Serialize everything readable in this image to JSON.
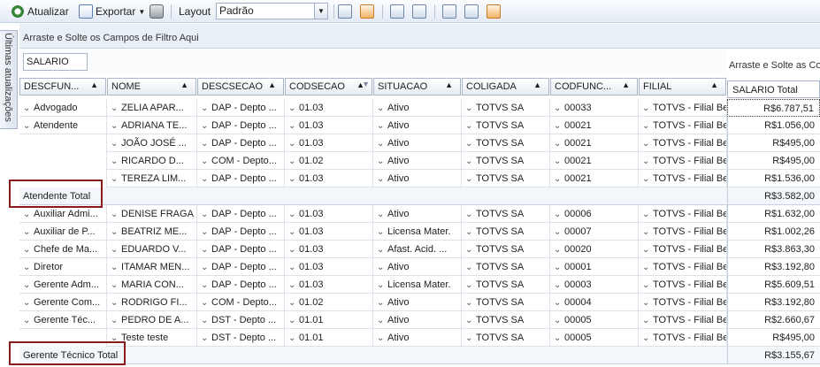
{
  "toolbar": {
    "refresh_label": "Atualizar",
    "export_label": "Exportar",
    "layout_label": "Layout",
    "layout_value": "Padrão"
  },
  "sidetab": {
    "label": "Últimas atualizações"
  },
  "grid": {
    "filter_area_hint": "Arraste e Solte os Campos de Filtro Aqui",
    "data_field": "SALARIO",
    "column_area_hint": "Arraste e Solte as Co",
    "value_header": "SALARIO Total",
    "row_headers": [
      "DESCFUN...",
      "NOME",
      "DESCSECAO",
      "CODSECAO",
      "SITUACAO",
      "COLIGADA",
      "CODFUNC...",
      "FILIAL"
    ],
    "rows": [
      {
        "c": [
          "Advogado",
          "ZELIA APAR...",
          "DAP - Depto ...",
          "01.03",
          "Ativo",
          "TOTVS SA",
          "00033",
          "TOTVS - Filial Be..."
        ],
        "v": "R$6.787,51"
      },
      {
        "c": [
          "Atendente",
          "ADRIANA TE...",
          "DAP - Depto ...",
          "01.03",
          "Ativo",
          "TOTVS SA",
          "00021",
          "TOTVS - Filial Be..."
        ],
        "v": "R$1.056,00"
      },
      {
        "c": [
          "",
          "JOÃO JOSÉ ...",
          "DAP - Depto ...",
          "01.03",
          "Ativo",
          "TOTVS SA",
          "00021",
          "TOTVS - Filial Be..."
        ],
        "v": "R$495,00"
      },
      {
        "c": [
          "",
          "RICARDO D...",
          "COM - Depto...",
          "01.02",
          "Ativo",
          "TOTVS SA",
          "00021",
          "TOTVS - Filial Be..."
        ],
        "v": "R$495,00"
      },
      {
        "c": [
          "",
          "TEREZA LIM...",
          "DAP - Depto ...",
          "01.03",
          "Ativo",
          "TOTVS SA",
          "00021",
          "TOTVS - Filial Be..."
        ],
        "v": "R$1.536,00"
      },
      {
        "total": "Atendente Total",
        "v": "R$3.582,00"
      },
      {
        "c": [
          "Auxiliar Admi...",
          "DENISE FRAGA",
          "DAP - Depto ...",
          "01.03",
          "Ativo",
          "TOTVS SA",
          "00006",
          "TOTVS - Filial Be..."
        ],
        "v": "R$1.632,00"
      },
      {
        "c": [
          "Auxiliar de P...",
          "BEATRIZ ME...",
          "DAP - Depto ...",
          "01.03",
          "Licensa Mater.",
          "TOTVS SA",
          "00007",
          "TOTVS - Filial Be..."
        ],
        "v": "R$1.002,26"
      },
      {
        "c": [
          "Chefe de Ma...",
          "EDUARDO V...",
          "DAP - Depto ...",
          "01.03",
          "Afast. Acid. ...",
          "TOTVS SA",
          "00020",
          "TOTVS - Filial Be..."
        ],
        "v": "R$3.863,30"
      },
      {
        "c": [
          "Diretor",
          "ITAMAR MEN...",
          "DAP - Depto ...",
          "01.03",
          "Ativo",
          "TOTVS SA",
          "00001",
          "TOTVS - Filial Be..."
        ],
        "v": "R$3.192,80"
      },
      {
        "c": [
          "Gerente Adm...",
          "MARIA CON...",
          "DAP - Depto ...",
          "01.03",
          "Licensa Mater.",
          "TOTVS SA",
          "00003",
          "TOTVS - Filial Be..."
        ],
        "v": "R$5.609,51"
      },
      {
        "c": [
          "Gerente Com...",
          "RODRIGO FI...",
          "COM - Depto...",
          "01.02",
          "Ativo",
          "TOTVS SA",
          "00004",
          "TOTVS - Filial Be..."
        ],
        "v": "R$3.192,80"
      },
      {
        "c": [
          "Gerente Téc...",
          "PEDRO DE A...",
          "DST - Depto ...",
          "01.01",
          "Ativo",
          "TOTVS SA",
          "00005",
          "TOTVS - Filial Be..."
        ],
        "v": "R$2.660,67"
      },
      {
        "c": [
          "",
          "Teste teste",
          "DST - Depto ...",
          "01.01",
          "Ativo",
          "TOTVS SA",
          "00005",
          "TOTVS - Filial Be..."
        ],
        "v": "R$495,00"
      },
      {
        "total": "Gerente Técnico Total",
        "v": "R$3.155,67"
      }
    ]
  }
}
